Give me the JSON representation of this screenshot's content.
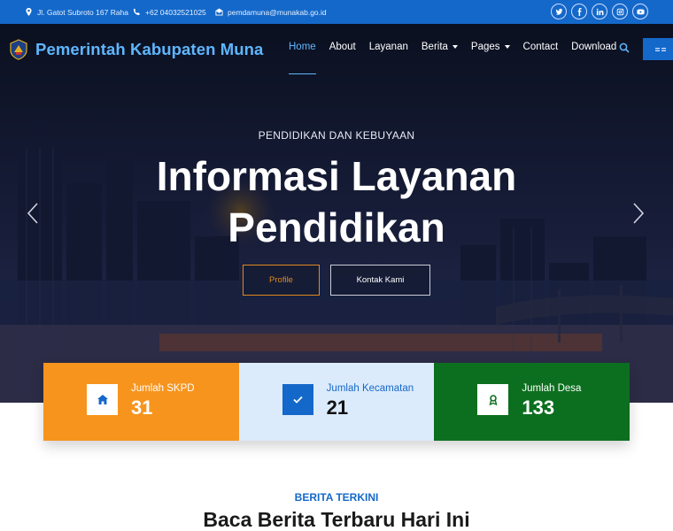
{
  "topbar": {
    "address": "Jl. Gatot Subroto 167 Raha",
    "phone": "+62 04032521025",
    "email": "pemdamuna@munakab.go.id",
    "socials": [
      "twitter-icon",
      "facebook-icon",
      "linkedin-icon",
      "instagram-icon",
      "youtube-icon"
    ]
  },
  "brand": {
    "name": "Pemerintah Kabupaten Muna"
  },
  "nav": {
    "items": [
      {
        "label": "Home"
      },
      {
        "label": "About"
      },
      {
        "label": "Layanan"
      },
      {
        "label": "Berita"
      },
      {
        "label": "Pages"
      },
      {
        "label": "Contact"
      },
      {
        "label": "Download"
      }
    ],
    "active": "Home"
  },
  "hero": {
    "subtitle": "PENDIDIKAN DAN KEBUYAAN",
    "title_line1": "Informasi Layanan",
    "title_line2": "Pendidikan",
    "btn_profile": "Profile",
    "btn_contact": "Kontak Kami"
  },
  "stats": [
    {
      "label": "Jumlah SKPD",
      "value": "31",
      "icon": "home-icon"
    },
    {
      "label": "Jumlah Kecamatan",
      "value": "21",
      "icon": "check-icon"
    },
    {
      "label": "Jumlah Desa",
      "value": "133",
      "icon": "award-icon"
    }
  ],
  "news": {
    "kicker": "BERITA TERKINI",
    "title": "Baca Berita Terbaru Hari Ini"
  },
  "colors": {
    "primary": "#1468c9",
    "accent_orange": "#f7941d",
    "green": "#0c6f1f",
    "light_blue": "#dcebfb"
  }
}
